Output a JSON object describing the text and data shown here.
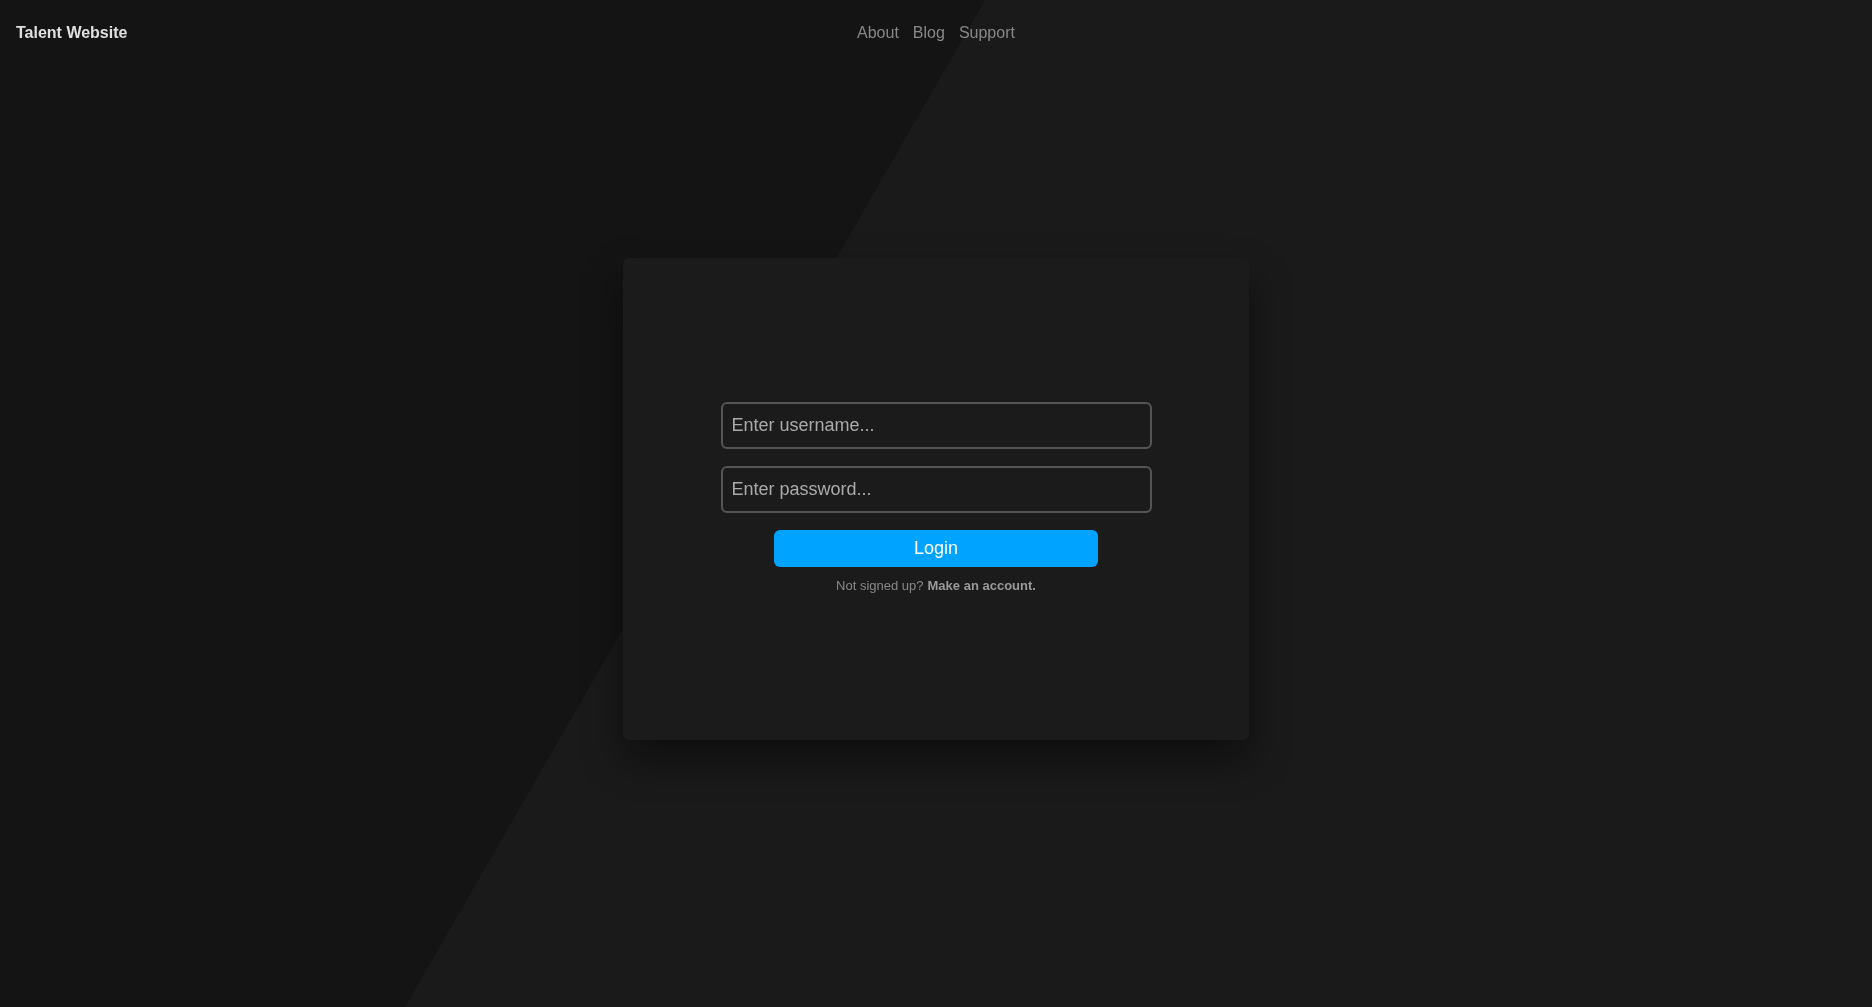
{
  "header": {
    "title": "Talent Website",
    "nav": [
      "About",
      "Blog",
      "Support"
    ]
  },
  "login_form": {
    "username": {
      "placeholder": "Enter username..."
    },
    "password": {
      "placeholder": "Enter password..."
    },
    "button": "Login",
    "signup": {
      "prompt": "Not signed up?",
      "link": "Make an account."
    }
  }
}
